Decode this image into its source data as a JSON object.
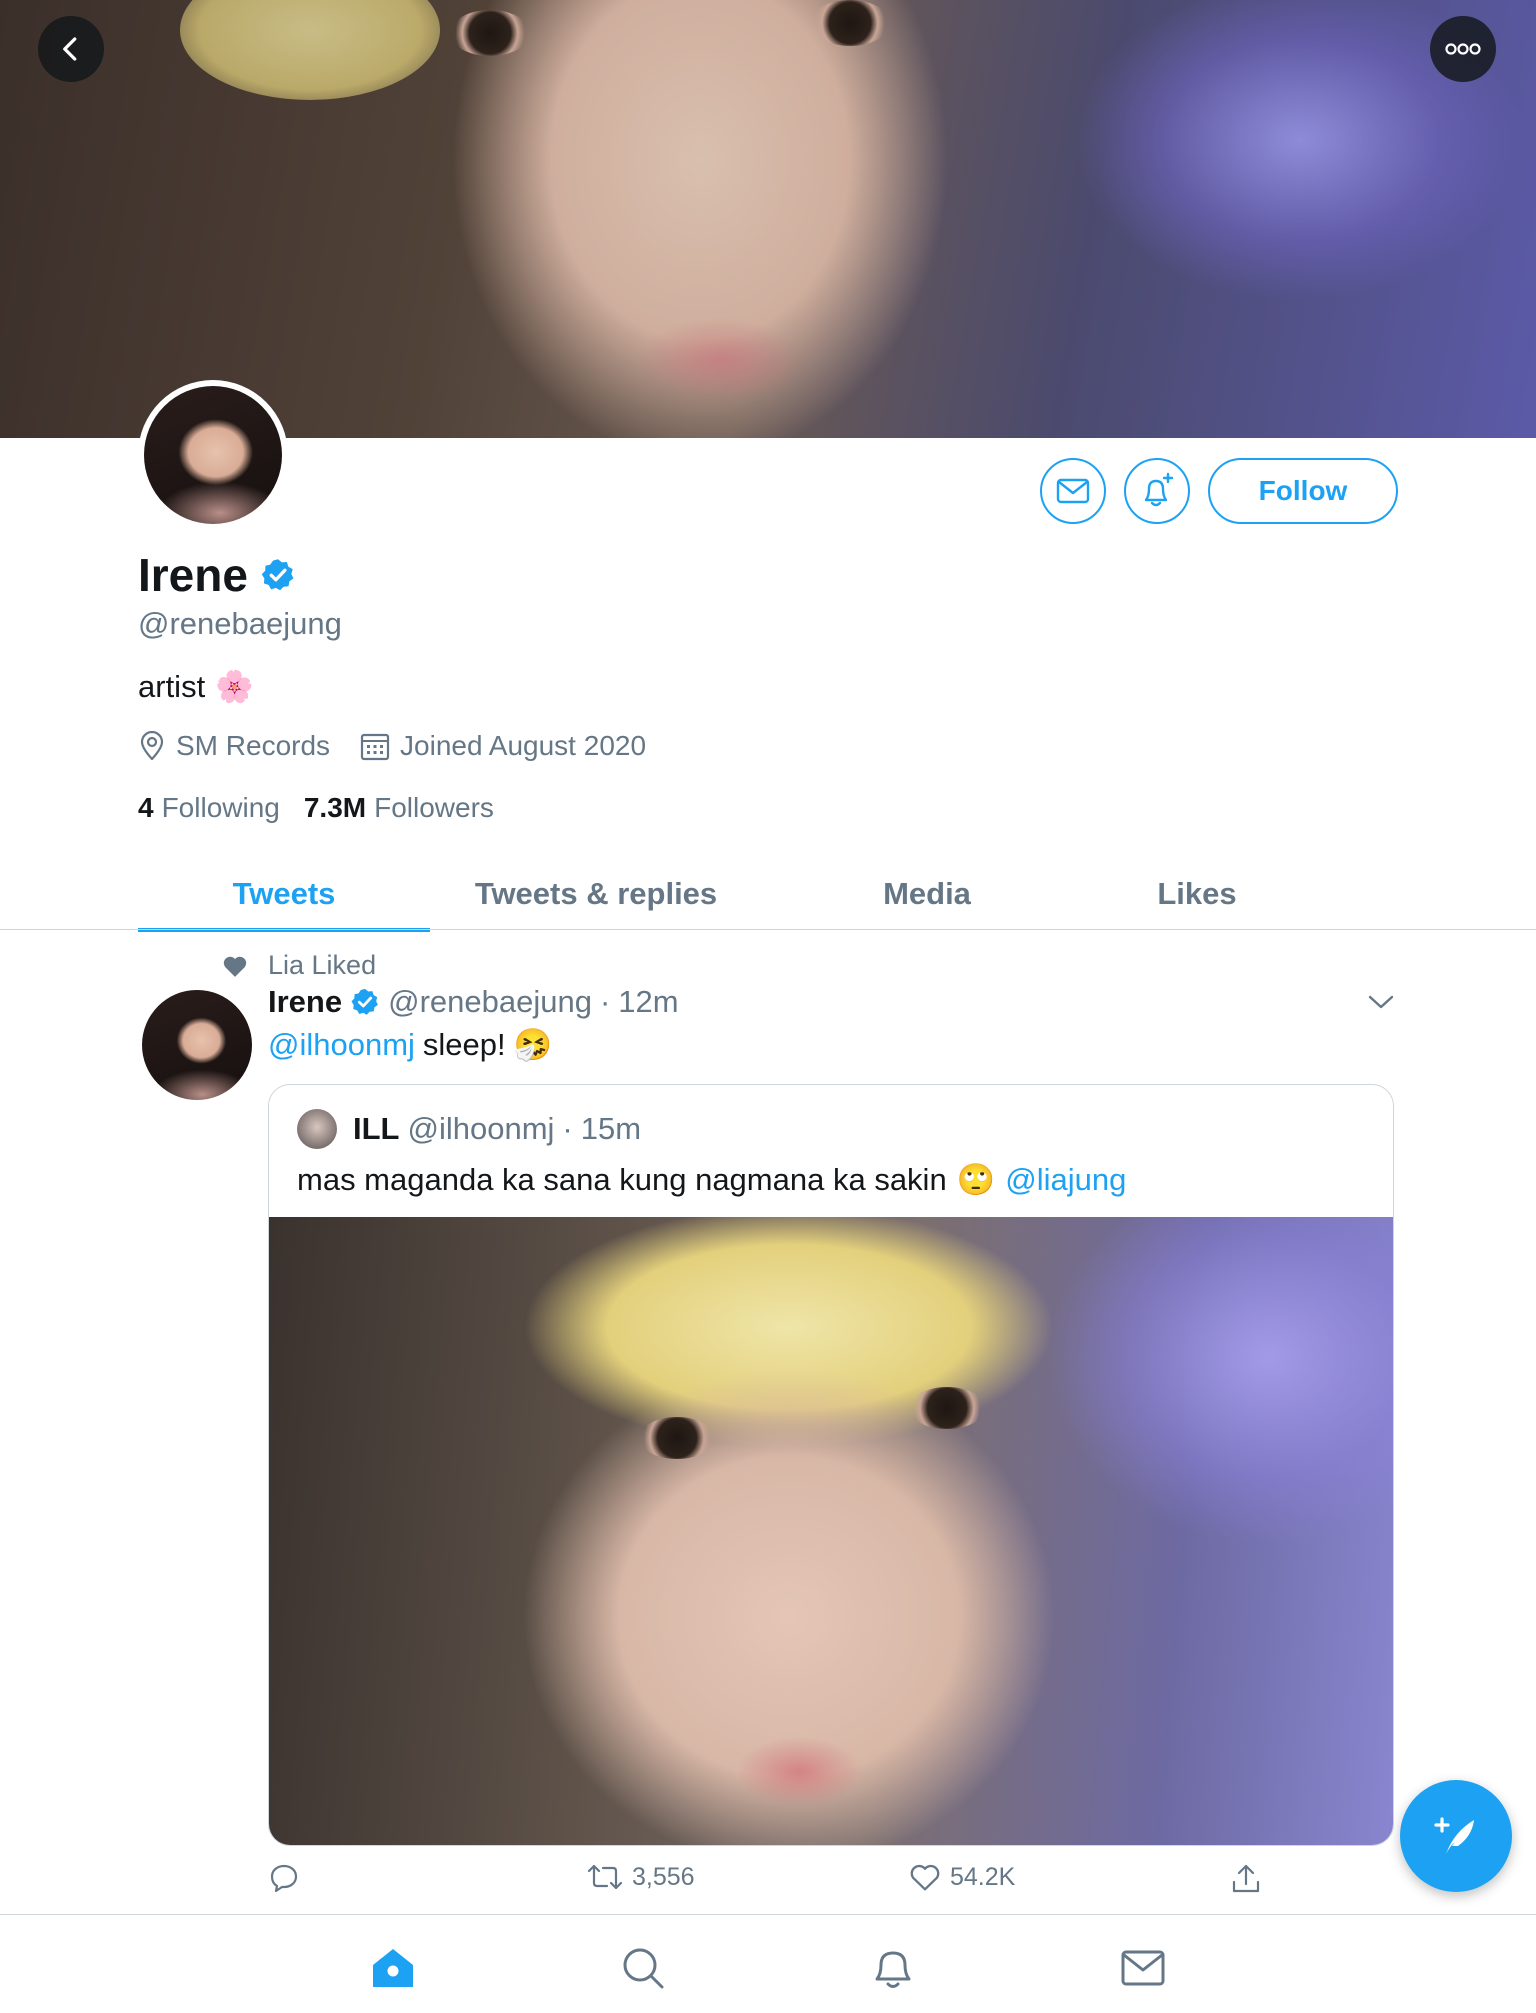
{
  "colors": {
    "accent": "#1da1f2",
    "muted": "#657786",
    "text": "#14171a",
    "divider": "#ccd6dd"
  },
  "header": {
    "back_icon": "chevron-left-icon",
    "more_icon": "more-horizontal-icon"
  },
  "profile": {
    "name": "Irene",
    "verified": true,
    "handle": "@renebaejung",
    "bio": "artist",
    "bio_emoji": "🌸",
    "location": "SM Records",
    "joined": "Joined August 2020",
    "following_count": "4",
    "following_label": "Following",
    "followers_count": "7.3M",
    "followers_label": "Followers",
    "follow_label": "Follow",
    "message_icon": "mail-icon",
    "notify_icon": "bell-plus-icon"
  },
  "tabs": [
    {
      "label": "Tweets",
      "active": true
    },
    {
      "label": "Tweets & replies",
      "active": false
    },
    {
      "label": "Media",
      "active": false
    },
    {
      "label": "Likes",
      "active": false
    }
  ],
  "tweet": {
    "social_context": "Lia Liked",
    "author_name": "Irene",
    "author_handle": "@renebaejung",
    "separator": "·",
    "time": "12m",
    "mention": "@ilhoonmj",
    "text": "sleep!",
    "emoji": "🤧",
    "quote": {
      "name": "ILL",
      "handle": "@ilhoonmj",
      "separator": "·",
      "time": "15m",
      "text": "mas maganda ka sana kung nagmana ka sakin",
      "emoji": "🙄",
      "mention": "@liajung"
    },
    "actions": {
      "reply_count": "",
      "retweet_count": "3,556",
      "like_count": "54.2K"
    }
  },
  "compose_icon": "compose-feather-icon",
  "bottom_nav": [
    "home-icon",
    "search-icon",
    "notifications-icon",
    "messages-icon"
  ]
}
